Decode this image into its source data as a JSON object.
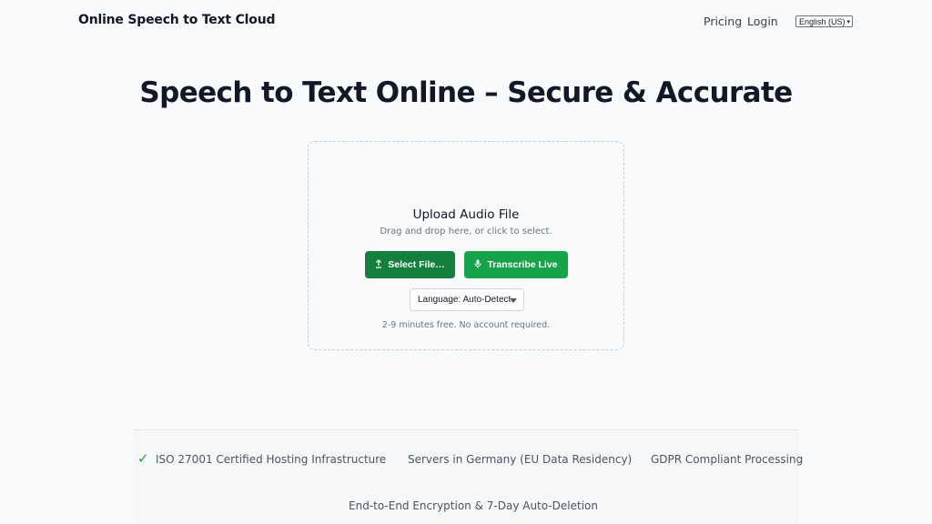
{
  "header": {
    "brand": "Online Speech to Text Cloud",
    "nav": [
      {
        "label": "Pricing"
      },
      {
        "label": "Login"
      }
    ],
    "language_select": {
      "value": "English (US)",
      "caret": "▾"
    }
  },
  "hero": {
    "title": "Speech to Text Online – Secure & Accurate"
  },
  "upload": {
    "title": "Upload Audio File",
    "subtitle": "Drag and drop here, or click to select.",
    "select_button": {
      "label": "Select File…",
      "icon": "upload-icon"
    },
    "live_button": {
      "label": "Transcribe Live",
      "icon": "microphone-icon"
    },
    "language_dropdown": {
      "value": "Language: Auto-Detect"
    },
    "note": "2-9 minutes free. No account required."
  },
  "trust": {
    "check_glyph": "✓",
    "items": [
      "ISO 27001 Certified Hosting Infrastructure",
      "Servers in Germany (EU Data Residency)",
      "GDPR Compliant Processing",
      "End-to-End Encryption & 7-Day Auto-Deletion"
    ]
  },
  "colors": {
    "accent_dark": "#15803d",
    "accent": "#16a34a",
    "text": "#111827",
    "muted": "#6b7280"
  }
}
